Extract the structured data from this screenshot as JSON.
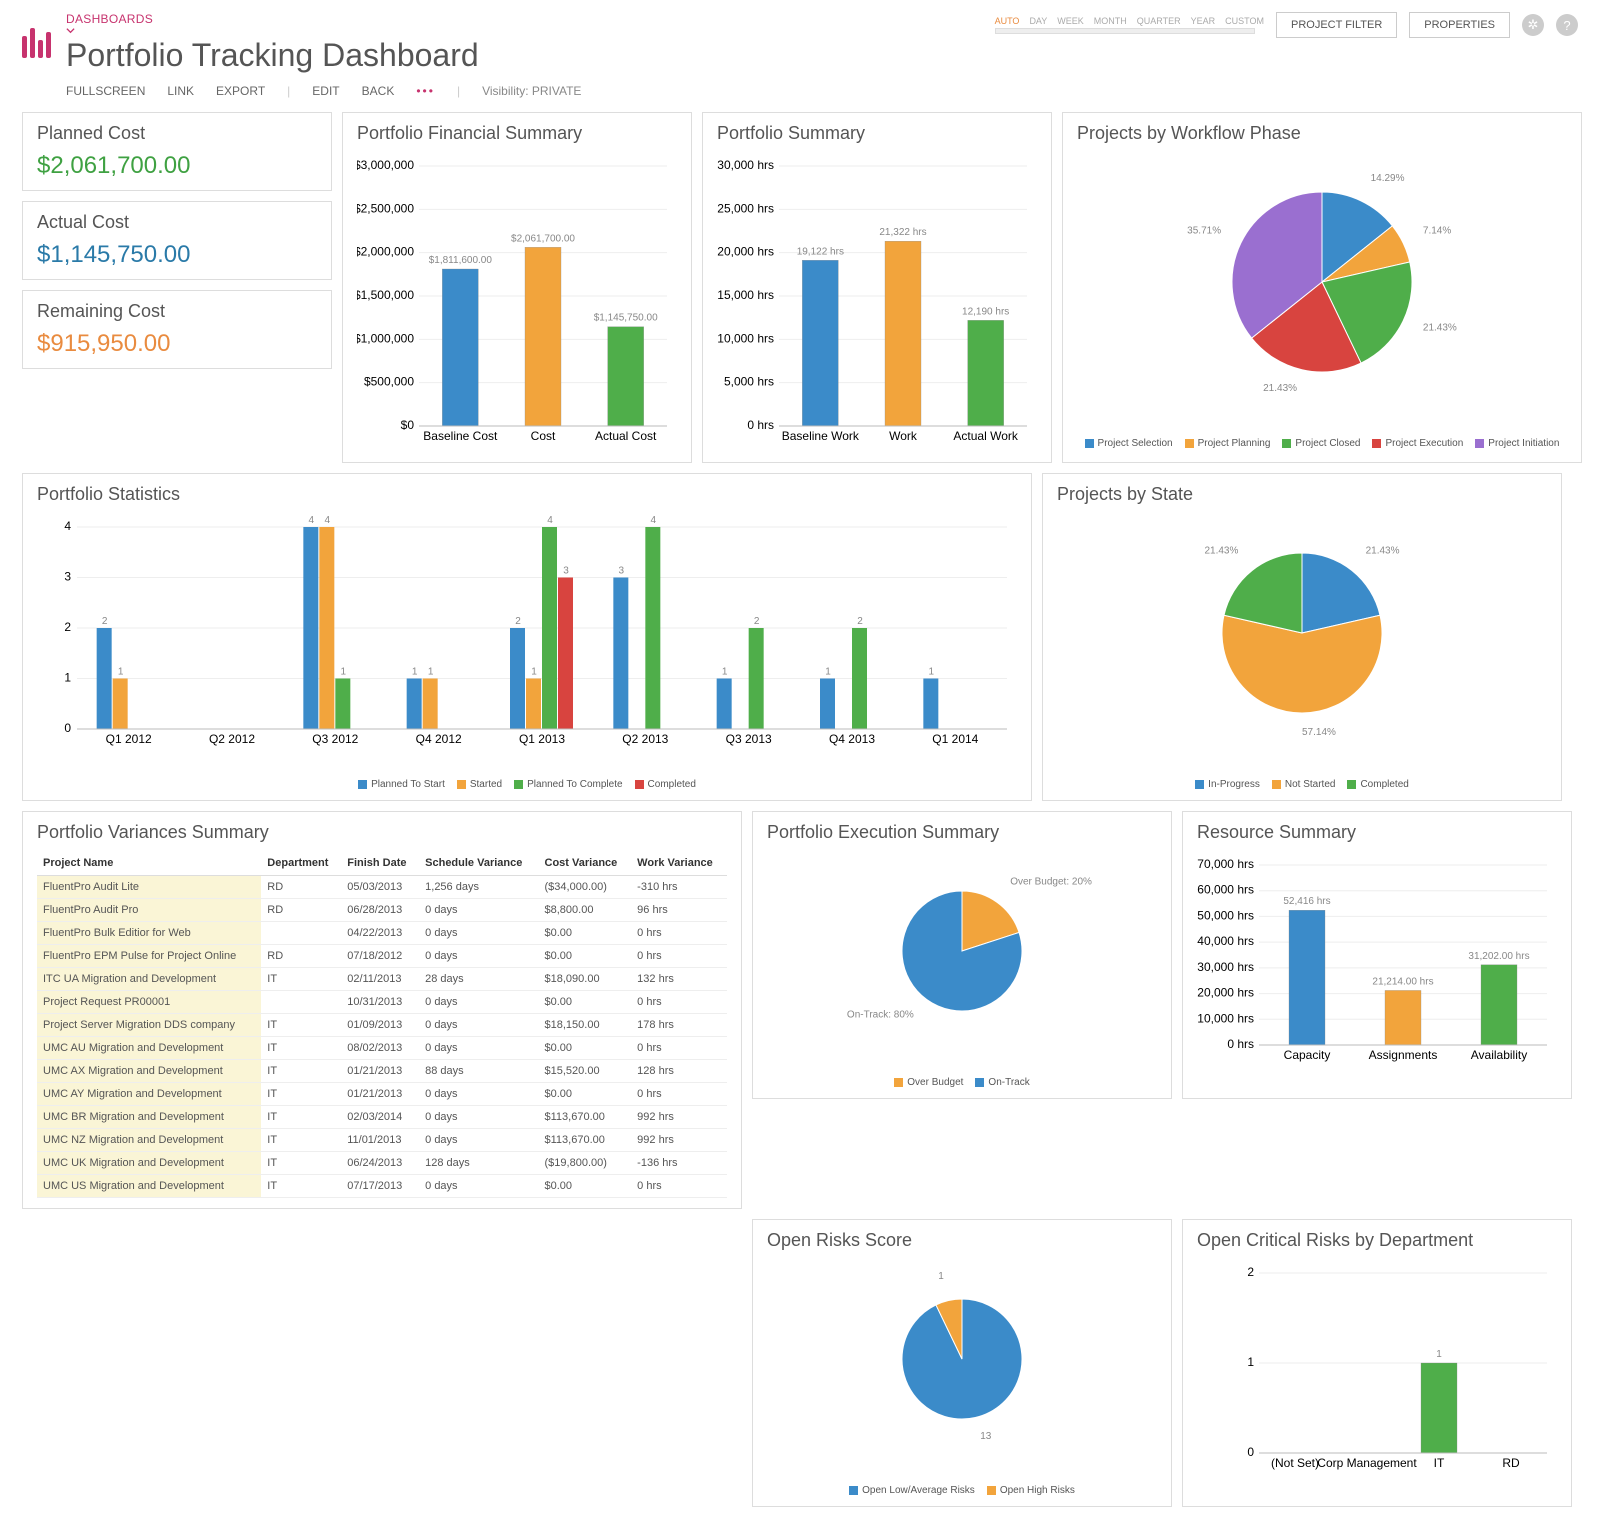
{
  "header": {
    "crumb": "DASHBOARDS",
    "title": "Portfolio Tracking Dashboard",
    "toolbar": [
      "FULLSCREEN",
      "LINK",
      "EXPORT",
      "|",
      "EDIT",
      "BACK",
      "•••",
      "|",
      "Visibility: PRIVATE"
    ],
    "timeframe": [
      "AUTO",
      "DAY",
      "WEEK",
      "MONTH",
      "QUARTER",
      "YEAR",
      "CUSTOM"
    ],
    "tf_selected": "AUTO",
    "btn_filter": "PROJECT FILTER",
    "btn_props": "PROPERTIES"
  },
  "kpi": {
    "planned": {
      "label": "Planned Cost",
      "val": "$2,061,700.00"
    },
    "actual": {
      "label": "Actual Cost",
      "val": "$1,145,750.00"
    },
    "remain": {
      "label": "Remaining Cost",
      "val": "$915,950.00"
    }
  },
  "colors": {
    "blue": "#3b8bc9",
    "orange": "#f2a43c",
    "green": "#4fae4a",
    "red": "#d8443f",
    "purple": "#9a6fd0"
  },
  "chart_data": [
    {
      "id": "fin",
      "title": "Portfolio Financial Summary",
      "type": "bar",
      "categories": [
        "Baseline Cost",
        "Cost",
        "Actual Cost"
      ],
      "values": [
        1811600,
        2061700,
        1145750
      ],
      "labels": [
        "$1,811,600.00",
        "$2,061,700.00",
        "$1,145,750.00"
      ],
      "colors": [
        "blue",
        "orange",
        "green"
      ],
      "yticks": [
        0,
        500000,
        1000000,
        1500000,
        2000000,
        2500000,
        3000000
      ],
      "yfmt": [
        "$0",
        "$500,000",
        "$1,000,000",
        "$1,500,000",
        "$2,000,000",
        "$2,500,000",
        "$3,000,000"
      ]
    },
    {
      "id": "sum",
      "title": "Portfolio Summary",
      "type": "bar",
      "categories": [
        "Baseline Work",
        "Work",
        "Actual Work"
      ],
      "values": [
        19122,
        21322,
        12190
      ],
      "labels": [
        "19,122 hrs",
        "21,322 hrs",
        "12,190 hrs"
      ],
      "colors": [
        "blue",
        "orange",
        "green"
      ],
      "yticks": [
        0,
        5000,
        10000,
        15000,
        20000,
        25000,
        30000
      ],
      "yfmt": [
        "0 hrs",
        "5,000 hrs",
        "10,000 hrs",
        "15,000 hrs",
        "20,000 hrs",
        "25,000 hrs",
        "30,000 hrs"
      ]
    },
    {
      "id": "phase",
      "title": "Projects by Workflow Phase",
      "type": "pie",
      "slices": [
        {
          "name": "Project Selection",
          "value": 14.29,
          "color": "blue"
        },
        {
          "name": "Project Planning",
          "value": 7.14,
          "color": "orange"
        },
        {
          "name": "Project Closed",
          "value": 21.43,
          "color": "green"
        },
        {
          "name": "Project Execution",
          "value": 21.43,
          "color": "red"
        },
        {
          "name": "Project Initiation",
          "value": 35.71,
          "color": "purple"
        }
      ]
    },
    {
      "id": "stats",
      "title": "Portfolio Statistics",
      "type": "bar",
      "categories": [
        "Q1 2012",
        "Q2 2012",
        "Q3 2012",
        "Q4 2012",
        "Q1 2013",
        "Q2 2013",
        "Q3 2013",
        "Q4 2013",
        "Q1 2014"
      ],
      "series": [
        {
          "name": "Planned To Start",
          "color": "blue",
          "values": [
            2,
            0,
            4,
            1,
            2,
            3,
            1,
            1,
            1
          ]
        },
        {
          "name": "Started",
          "color": "orange",
          "values": [
            1,
            0,
            4,
            1,
            1,
            0,
            0,
            0,
            0
          ]
        },
        {
          "name": "Planned To Complete",
          "color": "green",
          "values": [
            0,
            0,
            1,
            0,
            4,
            4,
            2,
            2,
            0
          ]
        },
        {
          "name": "Completed",
          "color": "red",
          "values": [
            0,
            0,
            0,
            0,
            3,
            0,
            0,
            0,
            0
          ]
        }
      ],
      "ymax": 4
    },
    {
      "id": "state",
      "title": "Projects by State",
      "type": "pie",
      "slices": [
        {
          "name": "In-Progress",
          "value": 21.43,
          "color": "blue"
        },
        {
          "name": "Not Started",
          "value": 57.14,
          "color": "orange"
        },
        {
          "name": "Completed",
          "value": 21.43,
          "color": "green"
        }
      ]
    },
    {
      "id": "exec",
      "title": "Portfolio Execution Summary",
      "type": "pie",
      "slices": [
        {
          "name": "Over Budget",
          "value": 20,
          "color": "orange",
          "label": "Over Budget: 20%"
        },
        {
          "name": "On-Track",
          "value": 80,
          "color": "blue",
          "label": "On-Track: 80%"
        }
      ]
    },
    {
      "id": "risks",
      "title": "Open Risks Score",
      "type": "pie",
      "slices": [
        {
          "name": "Open Low/Average Risks",
          "value": 13,
          "color": "blue",
          "label": "13"
        },
        {
          "name": "Open High Risks",
          "value": 1,
          "color": "orange",
          "label": "1"
        }
      ]
    },
    {
      "id": "res",
      "title": "Resource Summary",
      "type": "bar",
      "categories": [
        "Capacity",
        "Assignments",
        "Availability"
      ],
      "values": [
        52416,
        21214,
        31202
      ],
      "labels": [
        "52,416 hrs",
        "21,214.00 hrs",
        "31,202.00 hrs"
      ],
      "colors": [
        "blue",
        "orange",
        "green"
      ],
      "yticks": [
        0,
        10000,
        20000,
        30000,
        40000,
        50000,
        60000,
        70000
      ],
      "yfmt": [
        "0 hrs",
        "10,000 hrs",
        "20,000 hrs",
        "30,000 hrs",
        "40,000 hrs",
        "50,000 hrs",
        "60,000 hrs",
        "70,000 hrs"
      ]
    },
    {
      "id": "dept",
      "title": "Open Critical Risks by Department",
      "type": "bar",
      "categories": [
        "(Not Set)",
        "Corp Management",
        "IT",
        "RD"
      ],
      "values": [
        0,
        0,
        1,
        0
      ],
      "labels": [
        "",
        "",
        "1",
        ""
      ],
      "colors": [
        "green",
        "green",
        "green",
        "green"
      ],
      "yticks": [
        0,
        1,
        2
      ],
      "yfmt": [
        "0",
        "1",
        "2"
      ]
    }
  ],
  "variances": {
    "title": "Portfolio Variances Summary",
    "cols": [
      "Project Name",
      "Department",
      "Finish Date",
      "Schedule Variance",
      "Cost Variance",
      "Work Variance"
    ],
    "rows": [
      [
        "FluentPro Audit Lite",
        "RD",
        "05/03/2013",
        "1,256 days",
        "($34,000.00)",
        "-310 hrs"
      ],
      [
        "FluentPro Audit Pro",
        "RD",
        "06/28/2013",
        "0 days",
        "$8,800.00",
        "96 hrs"
      ],
      [
        "FluentPro Bulk Editior for Web",
        "",
        "04/22/2013",
        "0 days",
        "$0.00",
        "0 hrs"
      ],
      [
        "FluentPro EPM Pulse for Project Online",
        "RD",
        "07/18/2012",
        "0 days",
        "$0.00",
        "0 hrs"
      ],
      [
        "ITC UA Migration and Development",
        "IT",
        "02/11/2013",
        "28 days",
        "$18,090.00",
        "132 hrs"
      ],
      [
        "Project Request PR00001",
        "",
        "10/31/2013",
        "0 days",
        "$0.00",
        "0 hrs"
      ],
      [
        "Project Server Migration DDS company",
        "IT",
        "01/09/2013",
        "0 days",
        "$18,150.00",
        "178 hrs"
      ],
      [
        "UMC AU Migration and Development",
        "IT",
        "08/02/2013",
        "0 days",
        "$0.00",
        "0 hrs"
      ],
      [
        "UMC AX Migration and Development",
        "IT",
        "01/21/2013",
        "88 days",
        "$15,520.00",
        "128 hrs"
      ],
      [
        "UMC AY Migration and Development",
        "IT",
        "01/21/2013",
        "0 days",
        "$0.00",
        "0 hrs"
      ],
      [
        "UMC BR Migration and Development",
        "IT",
        "02/03/2014",
        "0 days",
        "$113,670.00",
        "992 hrs"
      ],
      [
        "UMC NZ Migration and Development",
        "IT",
        "11/01/2013",
        "0 days",
        "$113,670.00",
        "992 hrs"
      ],
      [
        "UMC UK Migration and Development",
        "IT",
        "06/24/2013",
        "128 days",
        "($19,800.00)",
        "-136 hrs"
      ],
      [
        "UMC US Migration and Development",
        "IT",
        "07/17/2013",
        "0 days",
        "$0.00",
        "0 hrs"
      ]
    ]
  }
}
